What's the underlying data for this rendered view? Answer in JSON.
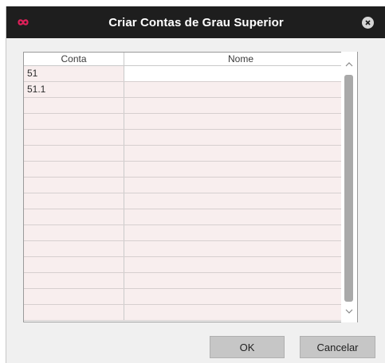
{
  "dialog": {
    "title": "Criar Contas de Grau Superior",
    "close_icon": "close-icon",
    "logo_icon": "infinity-logo-icon",
    "accent_color": "#e0205a"
  },
  "table": {
    "columns": [
      "Conta",
      "Nome"
    ],
    "rows": [
      {
        "conta": "51",
        "nome": ""
      },
      {
        "conta": "51.1",
        "nome": ""
      },
      {
        "conta": "",
        "nome": ""
      },
      {
        "conta": "",
        "nome": ""
      },
      {
        "conta": "",
        "nome": ""
      },
      {
        "conta": "",
        "nome": ""
      },
      {
        "conta": "",
        "nome": ""
      },
      {
        "conta": "",
        "nome": ""
      },
      {
        "conta": "",
        "nome": ""
      },
      {
        "conta": "",
        "nome": ""
      },
      {
        "conta": "",
        "nome": ""
      },
      {
        "conta": "",
        "nome": ""
      },
      {
        "conta": "",
        "nome": ""
      },
      {
        "conta": "",
        "nome": ""
      },
      {
        "conta": "",
        "nome": ""
      },
      {
        "conta": "",
        "nome": ""
      }
    ],
    "scroll_up_icon": "chevron-up-icon",
    "scroll_down_icon": "chevron-down-icon"
  },
  "buttons": {
    "ok_label": "OK",
    "cancel_label": "Cancelar"
  }
}
